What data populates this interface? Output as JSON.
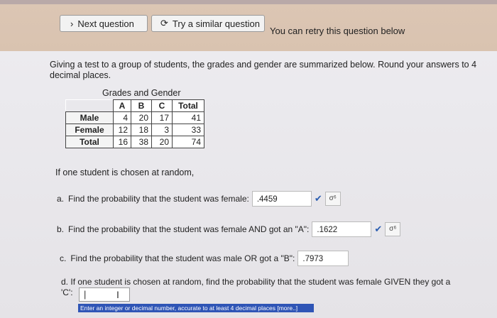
{
  "toolbar": {
    "next_label": "Next question",
    "similar_label": "Try a similar question",
    "retry_text": "You can retry this question below"
  },
  "question": {
    "intro": "Giving a test to a group of students, the grades and gender are summarized below. Round your answers to 4 decimal places.",
    "table_caption": "Grades and Gender",
    "table": {
      "headers": [
        "",
        "A",
        "B",
        "C",
        "Total"
      ],
      "rows": [
        [
          "Male",
          "4",
          "20",
          "17",
          "41"
        ],
        [
          "Female",
          "12",
          "18",
          "3",
          "33"
        ],
        [
          "Total",
          "16",
          "38",
          "20",
          "74"
        ]
      ]
    },
    "prompt": "If one student is chosen at random,"
  },
  "parts": {
    "a": {
      "letter": "a.",
      "text": "Find the probability that the student was female:",
      "answer": ".4459"
    },
    "b": {
      "letter": "b.",
      "text": "Find the probability that the student was female AND got an \"A\":",
      "answer": ".1622"
    },
    "c": {
      "letter": "c.",
      "text": "Find the probability that the student was male OR got a \"B\":",
      "answer": ".7973"
    },
    "d": {
      "letter": "d.",
      "text": "If one student is chosen at random, find the probability that the student was female GIVEN they got a",
      "text2": "'C':",
      "answer": ""
    }
  },
  "hint": "Enter an integer or decimal number, accurate to at least 4 decimal places [more..]",
  "colors": {
    "check": "#2a5db0",
    "hint_bg": "#2f55b6"
  }
}
